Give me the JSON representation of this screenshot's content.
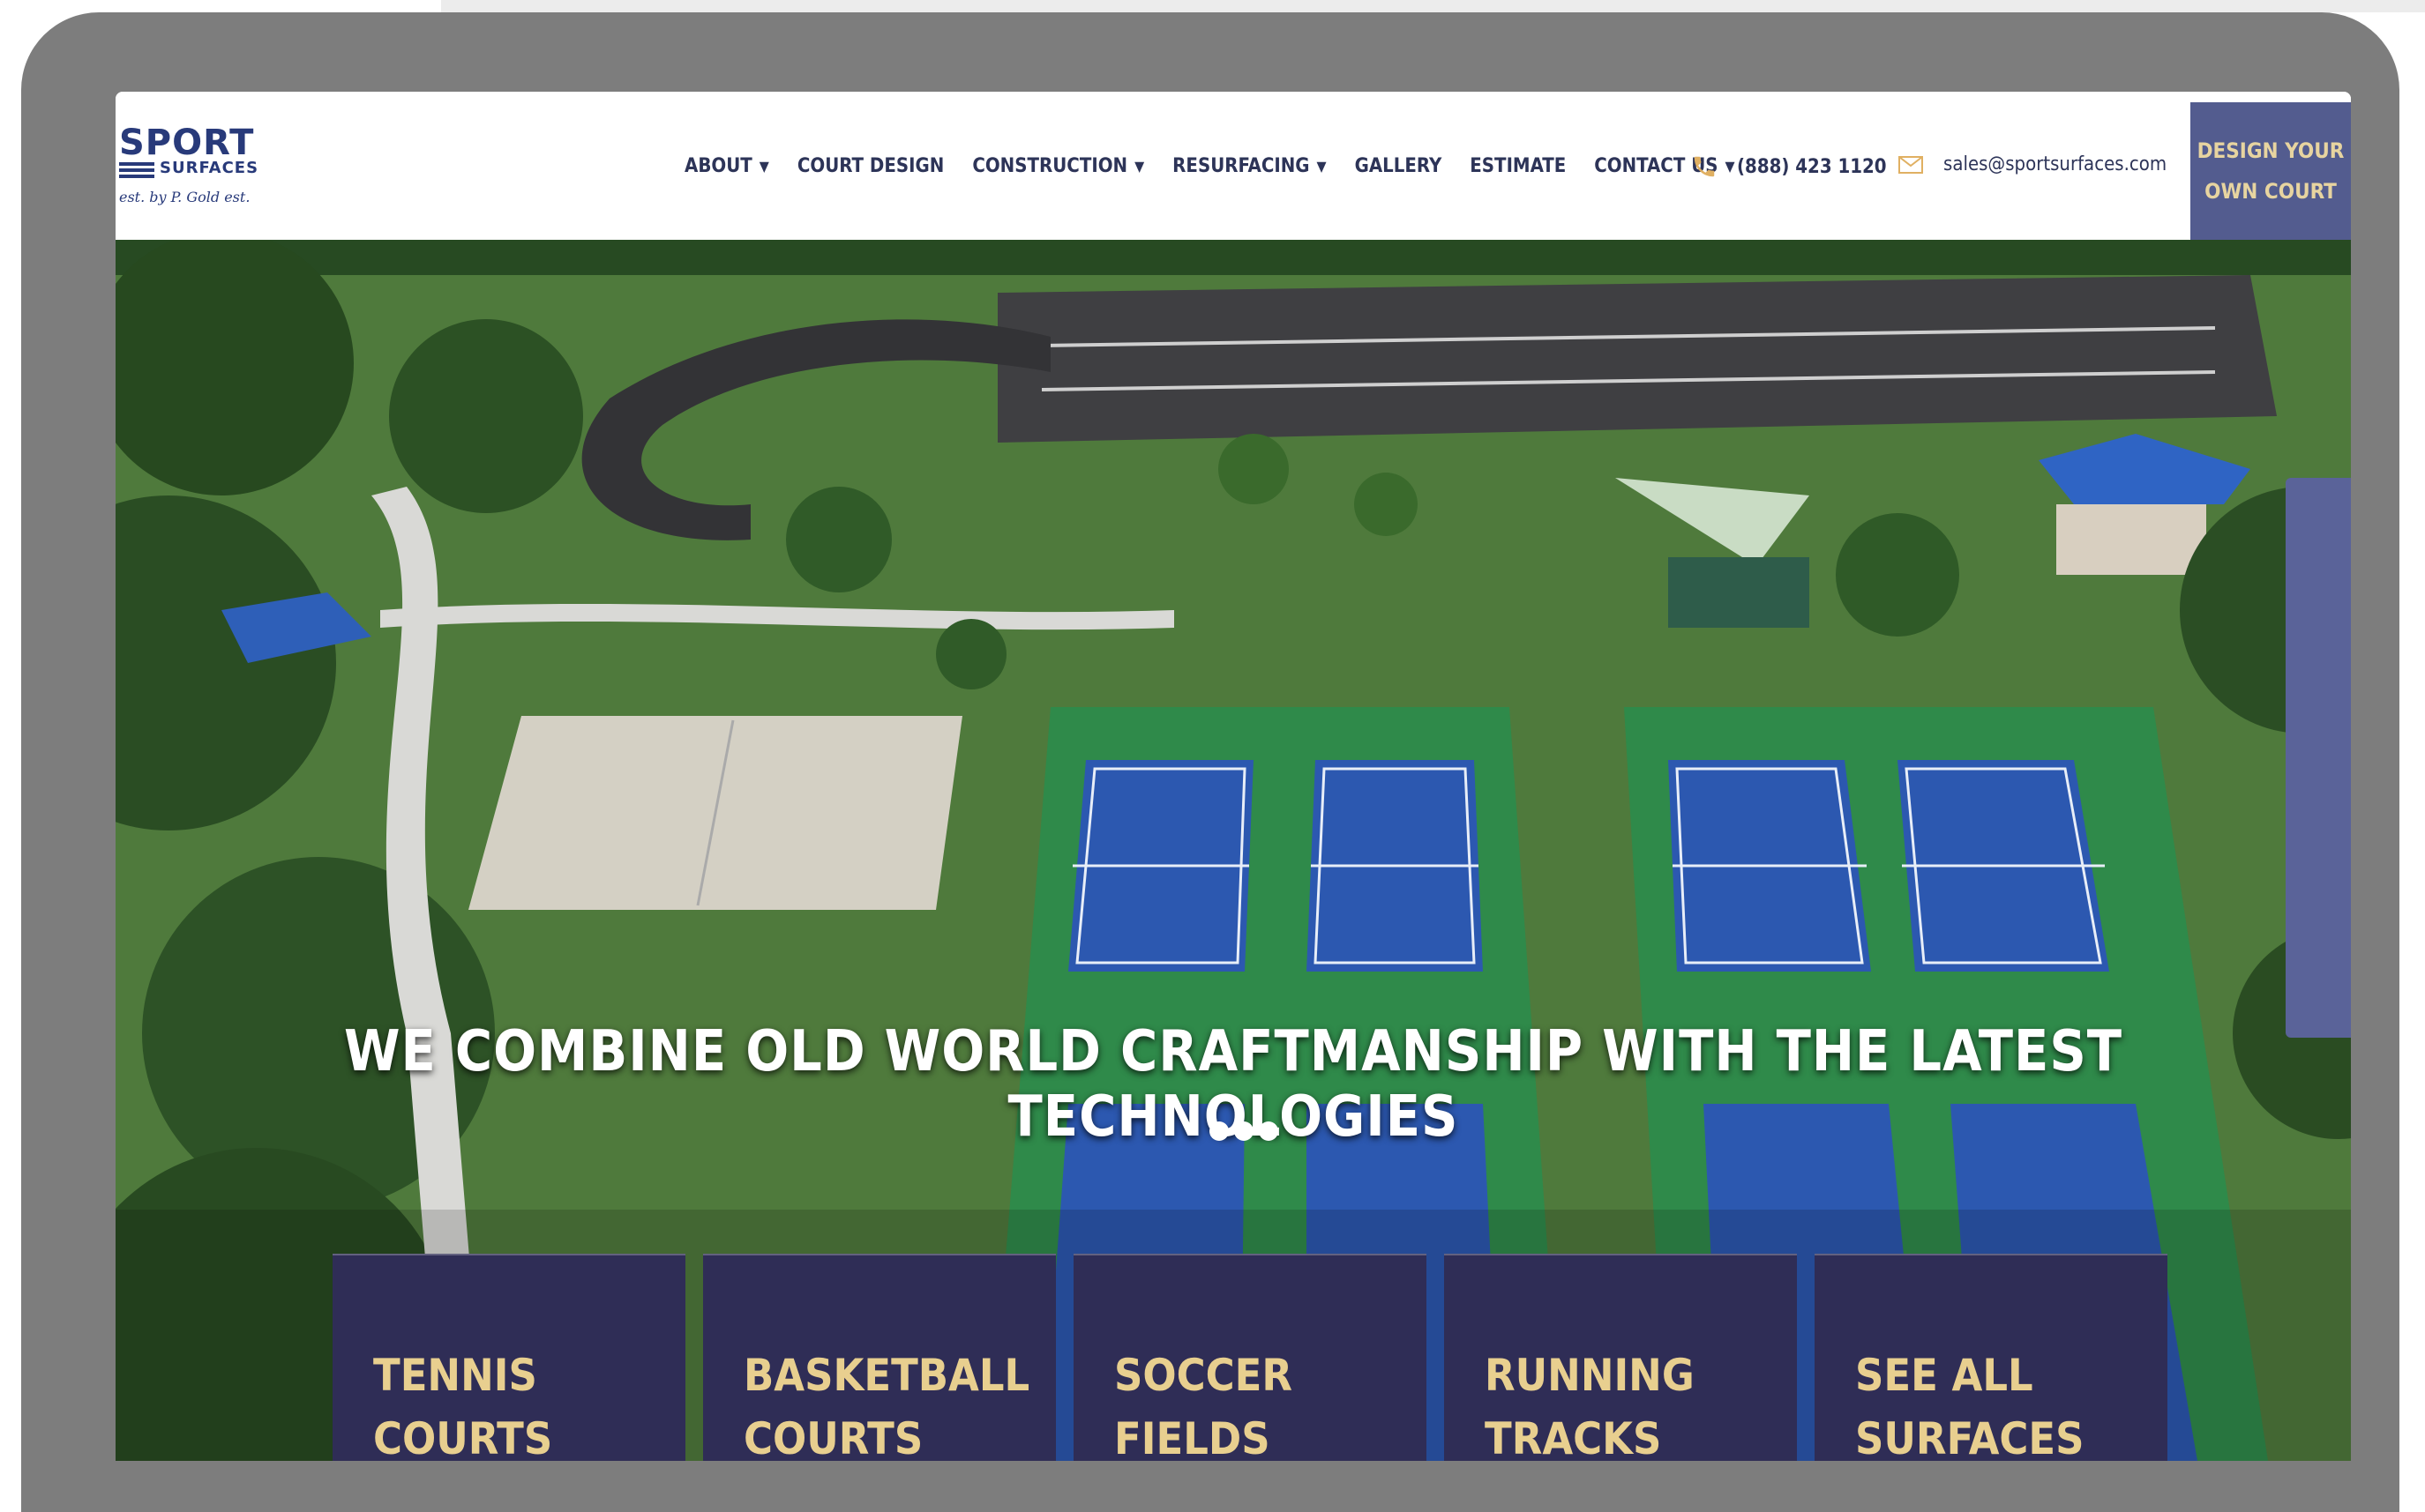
{
  "logo": {
    "title": "SPORT",
    "subtitle": "SURFACES",
    "script": "est. by P. Gold est."
  },
  "nav": {
    "items": [
      {
        "label": "ABOUT",
        "dropdown": true
      },
      {
        "label": "COURT DESIGN",
        "dropdown": false
      },
      {
        "label": "CONSTRUCTION",
        "dropdown": true
      },
      {
        "label": "RESURFACING",
        "dropdown": true
      },
      {
        "label": "GALLERY",
        "dropdown": false
      },
      {
        "label": "ESTIMATE",
        "dropdown": false
      },
      {
        "label": "CONTACT US",
        "dropdown": true
      }
    ],
    "caret": "▼"
  },
  "contact": {
    "phone": "(888) 423 1120",
    "email": "sales@sportsurfaces.com"
  },
  "cta": {
    "line1": "DESIGN YOUR",
    "line2": "OWN COURT"
  },
  "hero": {
    "headline": "WE COMBINE OLD WORLD CRAFTMANSHIP WITH THE LATEST TECHNOLOGIES",
    "slides": 3,
    "active_slide": 1
  },
  "tiles": [
    {
      "label": "TENNIS\nCOURTS"
    },
    {
      "label": "BASKETBALL\nCOURTS"
    },
    {
      "label": "SOCCER\nFIELDS"
    },
    {
      "label": "RUNNING\nTRACKS"
    },
    {
      "label": "SEE ALL\nSURFACES"
    }
  ],
  "colors": {
    "navy": "#2f2d56",
    "gold": "#e8cf8f",
    "cta_bg": "#535c8f",
    "brand_blue": "#283a7a",
    "frame": "#7d7d7d"
  }
}
